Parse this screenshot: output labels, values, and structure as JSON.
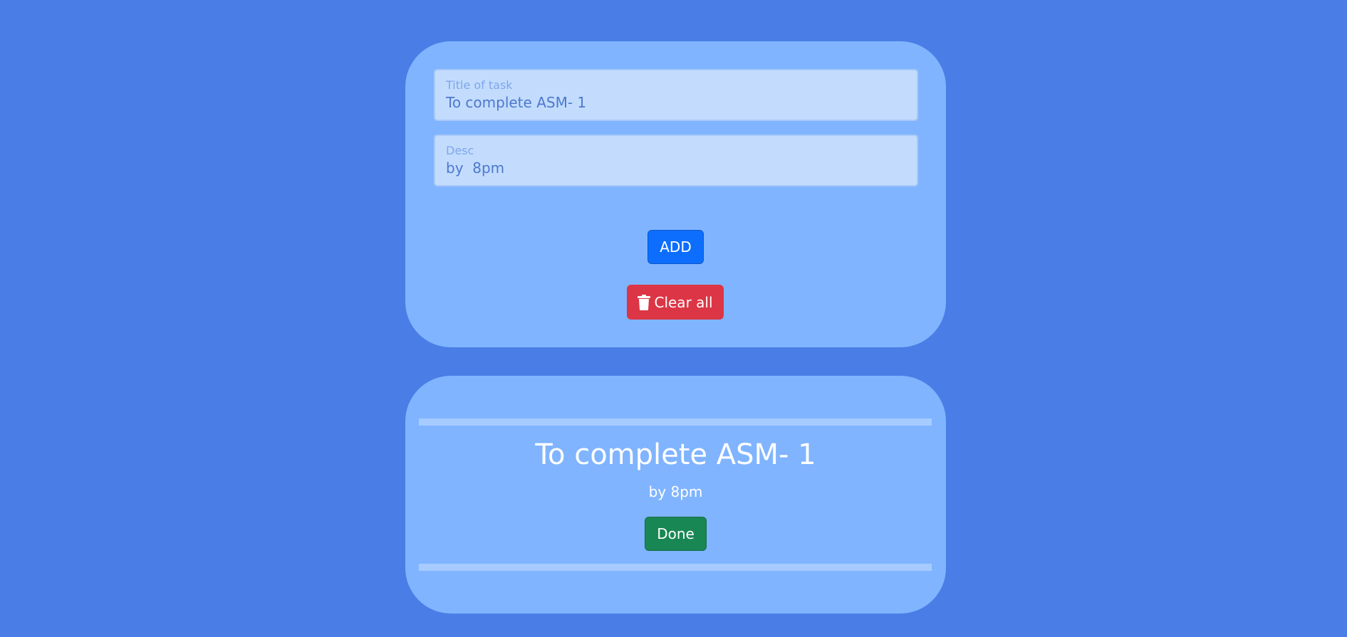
{
  "form": {
    "title_label": "Title of task",
    "title_value": "To complete ASM- 1",
    "desc_label": "Desc",
    "desc_value": "by  8pm",
    "add_label": "ADD",
    "clear_label": "Clear all"
  },
  "task": {
    "title": "To complete ASM- 1",
    "desc": "by 8pm",
    "done_label": "Done"
  },
  "icons": {
    "clear": "trash-icon"
  },
  "colors": {
    "background": "#4a7ee6",
    "card": "#80b4ff",
    "add": "#0d6efd",
    "clear": "#dc3545",
    "done": "#198754"
  }
}
